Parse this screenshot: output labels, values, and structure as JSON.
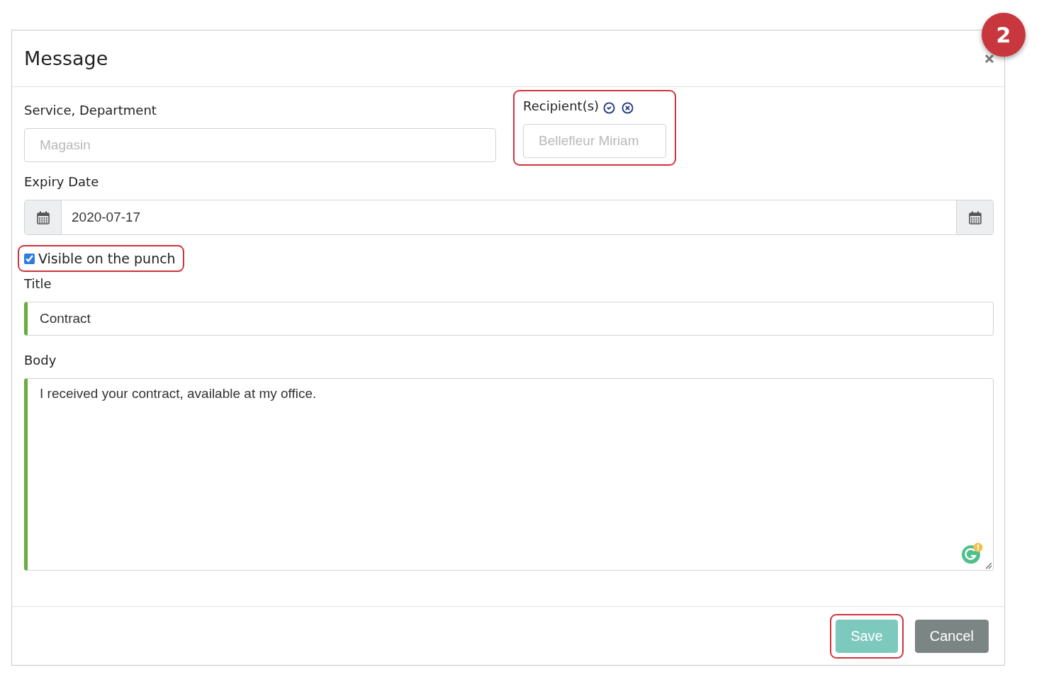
{
  "modal": {
    "title": "Message",
    "badge": "2"
  },
  "service": {
    "label": "Service, Department",
    "placeholder": "Magasin"
  },
  "recipients": {
    "label": "Recipient(s)",
    "placeholder": "Bellefleur Miriam",
    "highlighted": true
  },
  "expiry": {
    "label": "Expiry Date",
    "value": "2020-07-17"
  },
  "visible": {
    "label": "Visible on the punch",
    "checked": true,
    "highlighted": true
  },
  "title_field": {
    "label": "Title",
    "value": "Contract",
    "valid": true
  },
  "body": {
    "label": "Body",
    "value": "I received your contract, available at my office.",
    "valid": true
  },
  "buttons": [
    {
      "label": "Save",
      "kind": "primary",
      "highlighted": true
    },
    {
      "label": "Cancel",
      "kind": "secondary",
      "highlighted": false
    }
  ]
}
